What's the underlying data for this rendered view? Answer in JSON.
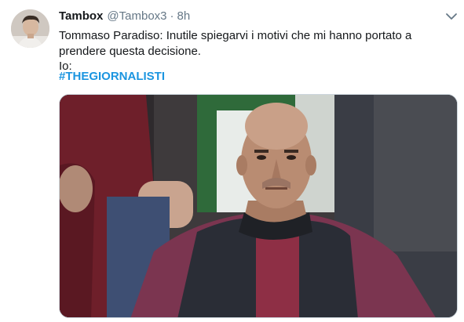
{
  "tweet": {
    "display_name": "Tambox",
    "handle": "@Tambox3",
    "separator": "·",
    "time": "8h",
    "text_lines": [
      "Tommaso Paradiso: Inutile spiegarvi i motivi che mi hanno portato a",
      "prendere questa decisione.",
      "Io:"
    ],
    "hashtag": "#THEGIORNALISTI"
  },
  "icons": {
    "more": "chevron-down-icon"
  },
  "colors": {
    "link": "#1b95e0",
    "secondary_text": "#657786",
    "primary_text": "#14171a"
  }
}
